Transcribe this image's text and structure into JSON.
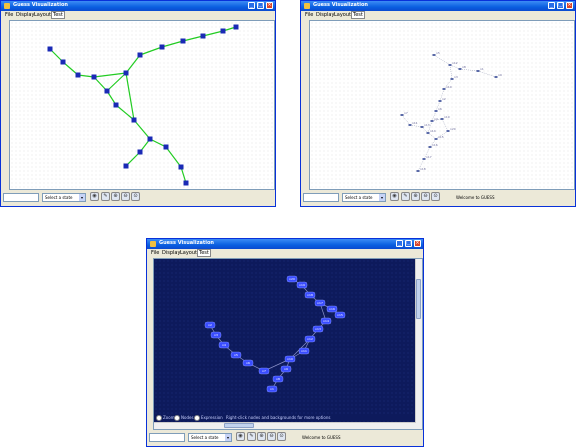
{
  "window_title": "Guess Visualization",
  "menu": [
    "File",
    "Display",
    "Layout",
    "Test"
  ],
  "controls": {
    "select_placeholder": "Select a state",
    "select_arrow": "▾",
    "status_message": "Welcome to GUESS",
    "tool_glyphs": [
      "◉",
      "✎",
      "⊕",
      "⊖",
      "⊙"
    ]
  },
  "titlebar_buttons": [
    "_",
    "□",
    "×"
  ],
  "dark_panel": {
    "radio_labels": [
      "Zoom",
      "Nodes",
      "Expression"
    ],
    "hint_text": "Right-click nodes and backgrounds for more options"
  },
  "colors": {
    "light_edge": "#22cc22",
    "light_node": "#1a2ab5",
    "sparse_edge": "#9aa0b8",
    "sparse_node": "#5a6aa8",
    "dark_bg": "#0d1a5c",
    "dark_node": "#3a4dff",
    "dark_edge": "#8a90c8",
    "titlebar": "#0a5fe0"
  },
  "graph": {
    "edges": [
      [
        0,
        1
      ],
      [
        1,
        2
      ],
      [
        2,
        3
      ],
      [
        3,
        4
      ],
      [
        5,
        6
      ],
      [
        6,
        7
      ],
      [
        7,
        8
      ],
      [
        8,
        9
      ],
      [
        9,
        4
      ],
      [
        4,
        10
      ],
      [
        10,
        11
      ],
      [
        11,
        2
      ],
      [
        10,
        12
      ],
      [
        11,
        12
      ],
      [
        12,
        13
      ],
      [
        13,
        14
      ],
      [
        13,
        15
      ],
      [
        15,
        16
      ],
      [
        13,
        17
      ],
      [
        17,
        18
      ],
      [
        18,
        19
      ]
    ]
  },
  "labels": {
    "mid_nodes": [
      "n5",
      "n12",
      "n8",
      "n1",
      "n9",
      "n3",
      "n10",
      "n2",
      "n6",
      "n4",
      "n7",
      "n11",
      "n13",
      "n14",
      "n15",
      "n16",
      "n17",
      "n18",
      "n19",
      "n20"
    ],
    "dark_nodes": [
      "n20",
      "n19",
      "n18",
      "n17",
      "n16",
      "n15",
      "n14",
      "n13",
      "n12",
      "n11",
      "n10",
      "n9",
      "n8",
      "n7",
      "n6",
      "n5",
      "n4",
      "n3",
      "n2",
      "n1"
    ]
  }
}
